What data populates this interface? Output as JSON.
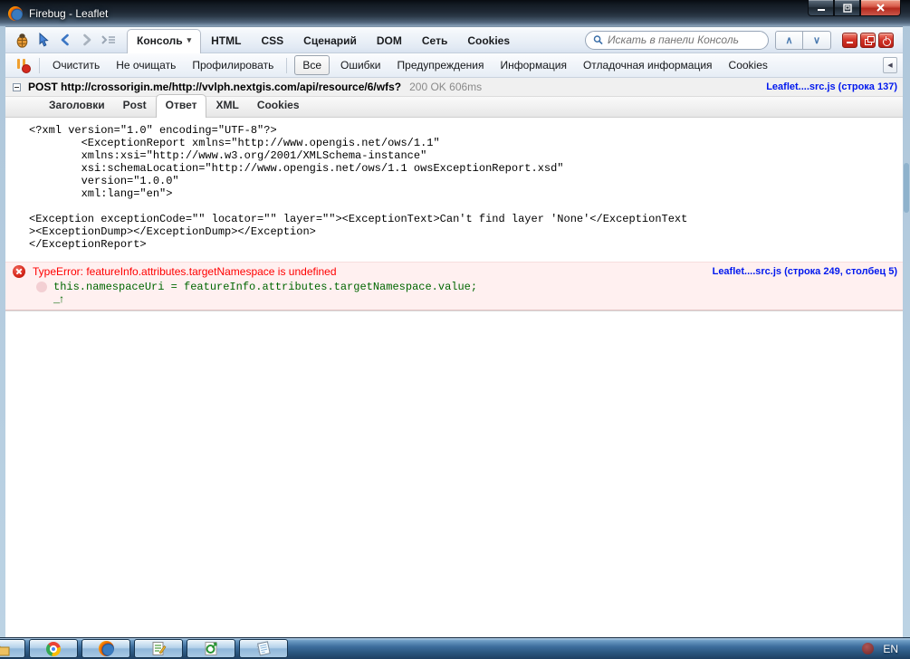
{
  "window": {
    "title": "Firebug - Leaflet"
  },
  "main_toolbar": {
    "icons": [
      "firebug-menu-icon",
      "inspect-element-icon",
      "back-icon",
      "forward-icon",
      "command-line-icon"
    ],
    "tabs": [
      {
        "label": "Консоль",
        "active": true,
        "has_dropdown": true
      },
      {
        "label": "HTML"
      },
      {
        "label": "CSS"
      },
      {
        "label": "Сценарий"
      },
      {
        "label": "DOM"
      },
      {
        "label": "Сеть"
      },
      {
        "label": "Cookies"
      }
    ],
    "search_placeholder": "Искать в панели Консоль",
    "window_buttons": [
      "minimize-firebug-icon",
      "detach-firebug-icon",
      "deactivate-firebug-icon"
    ]
  },
  "console_toolbar": {
    "break_icon": "break-on-all-errors-icon",
    "actions": [
      "Очистить",
      "Не очищать",
      "Профилировать"
    ],
    "filters": [
      {
        "label": "Все",
        "active": true
      },
      {
        "label": "Ошибки"
      },
      {
        "label": "Предупреждения"
      },
      {
        "label": "Информация"
      },
      {
        "label": "Отладочная информация"
      },
      {
        "label": "Cookies"
      }
    ]
  },
  "request_row": {
    "method": "POST",
    "url": "http://crossorigin.me/http://vvlph.nextgis.com/api/resource/6/wfs?",
    "status": "200 OK",
    "time": "606ms",
    "source_link": "Leaflet....src.js (строка 137)"
  },
  "request_tabs": [
    {
      "label": "Заголовки"
    },
    {
      "label": "Post"
    },
    {
      "label": "Ответ",
      "active": true
    },
    {
      "label": "XML"
    },
    {
      "label": "Cookies"
    }
  ],
  "response_xml_lines": [
    "<?xml version=\"1.0\" encoding=\"UTF-8\"?>",
    "        <ExceptionReport xmlns=\"http://www.opengis.net/ows/1.1\"",
    "        xmlns:xsi=\"http://www.w3.org/2001/XMLSchema-instance\"",
    "        xsi:schemaLocation=\"http://www.opengis.net/ows/1.1 owsExceptionReport.xsd\"",
    "        version=\"1.0.0\"",
    "        xml:lang=\"en\">",
    "",
    "<Exception exceptionCode=\"\" locator=\"\" layer=\"\"><ExceptionText>Can't find layer 'None'</ExceptionText",
    "><ExceptionDump></ExceptionDump></Exception>",
    "</ExceptionReport>"
  ],
  "error_row": {
    "message": "TypeError: featureInfo.attributes.targetNamespace is undefined",
    "source_link": "Leaflet....src.js (строка 249, столбец 5)",
    "code": "this.namespaceUri = featureInfo.attributes.targetNamespace.value;",
    "column_marker": "_↑"
  },
  "taskbar": {
    "items": [
      "folder-icon",
      "chrome-icon",
      "firefox-icon",
      "notepad-plus-icon",
      "qgis-icon",
      "notepad-icon"
    ],
    "language": "EN"
  },
  "colors": {
    "error_bg": "#FFF0F0",
    "error_text": "#FF0000",
    "code_green": "#006600",
    "link_blue": "#0018EE",
    "taskbar_blue": "#2A567F",
    "titlebar_dark": "#1F2935"
  }
}
